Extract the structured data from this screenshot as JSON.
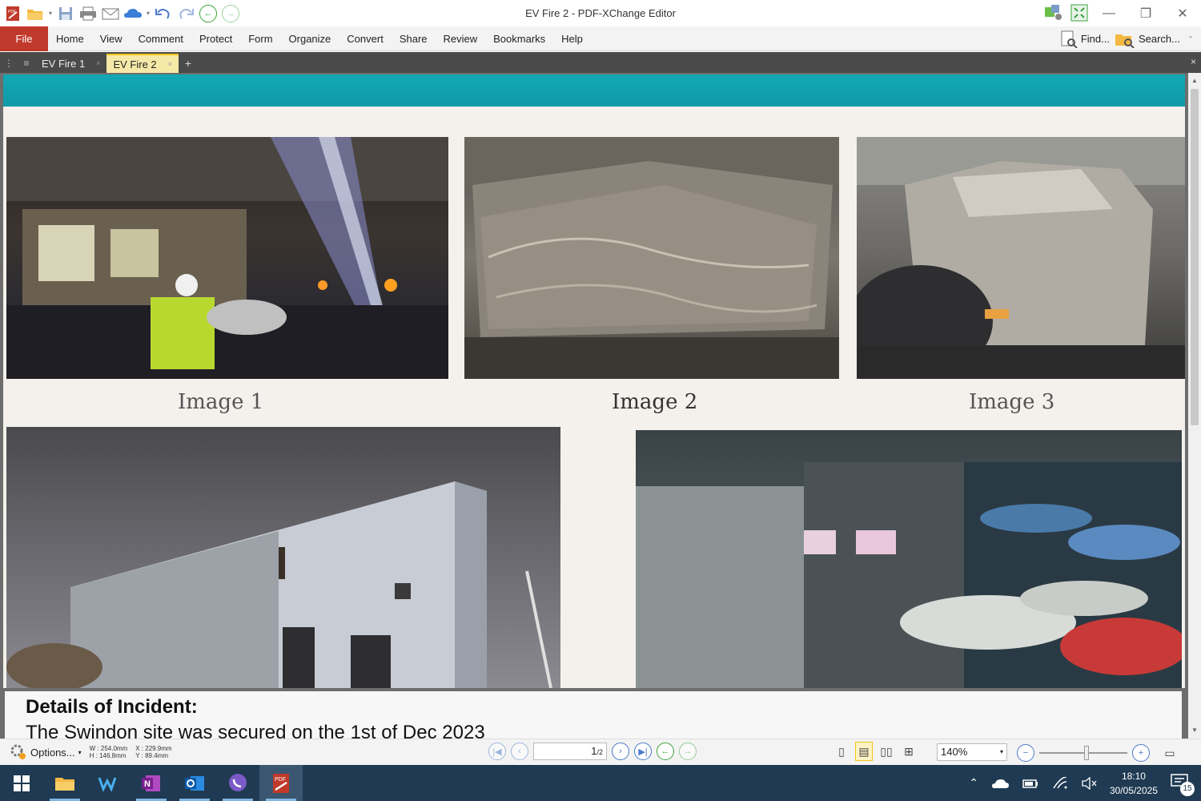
{
  "window": {
    "title": "EV Fire 2 - PDF-XChange Editor"
  },
  "menu": {
    "file": "File",
    "items": [
      "Home",
      "View",
      "Comment",
      "Protect",
      "Form",
      "Organize",
      "Convert",
      "Share",
      "Review",
      "Bookmarks",
      "Help"
    ],
    "find": "Find...",
    "search": "Search..."
  },
  "tabs": [
    {
      "label": "EV Fire 1",
      "active": false
    },
    {
      "label": "EV Fire 2",
      "active": true
    }
  ],
  "document": {
    "captions": [
      "Image 1",
      "Image 2",
      "Image 3"
    ],
    "heading": "Details of Incident:",
    "text_line": "The Swindon site was secured on the 1st of Dec 2023"
  },
  "statusbar": {
    "options": "Options...",
    "width": "W : 254.0mm",
    "height": "H : 146.8mm",
    "x": "X : 229.9mm",
    "y": "Y : 89.4mm",
    "page_current": "1",
    "page_total": "/2",
    "zoom": "140%"
  },
  "taskbar": {
    "time": "18:10",
    "date": "30/05/2025",
    "notifications": "15"
  },
  "colors": {
    "accent": "#c0392b",
    "teal_band": "#13a8b5",
    "taskbar": "#1f3a52"
  }
}
